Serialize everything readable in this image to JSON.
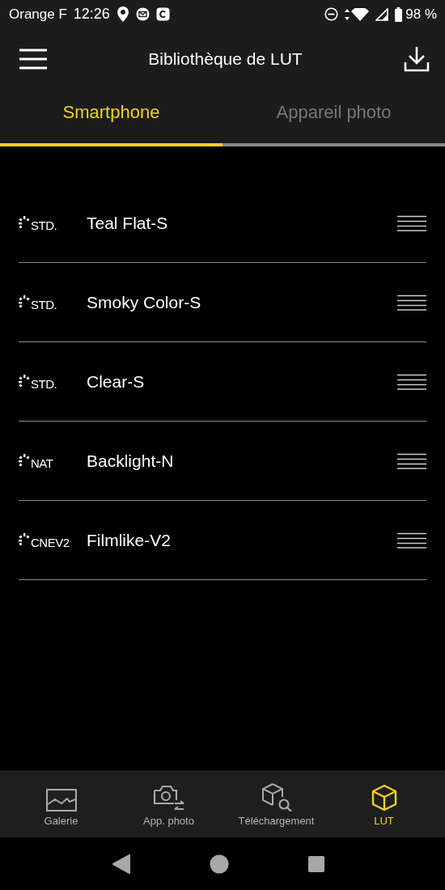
{
  "status_bar": {
    "carrier": "Orange F",
    "time": "12:26",
    "battery": "98 %"
  },
  "header": {
    "title": "Bibliothèque de LUT"
  },
  "tabs": [
    {
      "label": "Smartphone",
      "selected": true
    },
    {
      "label": "Appareil photo",
      "selected": false
    }
  ],
  "luts": [
    {
      "badge": "STD.",
      "name": "Teal Flat-S"
    },
    {
      "badge": "STD.",
      "name": "Smoky Color-S"
    },
    {
      "badge": "STD.",
      "name": "Clear-S"
    },
    {
      "badge": "NAT",
      "name": "Backlight-N"
    },
    {
      "badge": "CNEV2",
      "name": "Filmlike-V2"
    }
  ],
  "bottom_nav": [
    {
      "kind": "gallery",
      "label": "Galerie",
      "selected": false
    },
    {
      "kind": "camera",
      "label": "App. photo",
      "selected": false
    },
    {
      "kind": "download",
      "label": "Téléchargement",
      "selected": false
    },
    {
      "kind": "lut",
      "label": "LUT",
      "selected": true
    }
  ]
}
